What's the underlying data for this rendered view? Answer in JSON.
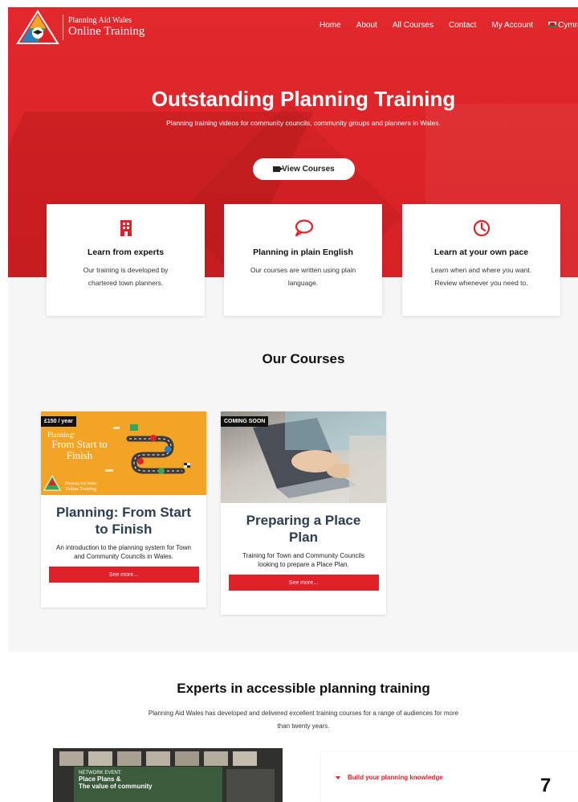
{
  "brand": {
    "line1": "Planning Aid Wales",
    "line2": "Online Training"
  },
  "nav": [
    "Home",
    "About",
    "All Courses",
    "Contact",
    "My Account"
  ],
  "nav_language": "Cymra",
  "hero": {
    "title": "Outstanding Planning Training",
    "subtitle": "Planning training videos for community councils, community groups and planners in Wales.",
    "button": "View Courses"
  },
  "features": [
    {
      "icon": "building-icon",
      "title": "Learn from experts",
      "desc": "Our training is developed by chartered town planners."
    },
    {
      "icon": "speech-bubble-icon",
      "title": "Planning in plain English",
      "desc": "Our courses are written using plain language."
    },
    {
      "icon": "clock-icon",
      "title": "Learn at your own pace",
      "desc": "Learn when and where you want. Review whenever you need to."
    }
  ],
  "courses_heading": "Our Courses",
  "courses": [
    {
      "badge": "£150 / year",
      "image_label": "Planning:",
      "image_title": "From Start to Finish",
      "image_brand_1": "Planning Aid Wales",
      "image_brand_2": "Online Training",
      "title": "Planning: From Start to Finish",
      "desc": "An introduction to the planning system for Town and Community Councils in Wales.",
      "button": "See more..."
    },
    {
      "badge": "COMING SOON",
      "title": "Preparing a Place Plan",
      "desc": "Training for Town and Community Councils looking to prepare a Place Plan.",
      "button": "See more..."
    }
  ],
  "experts": {
    "title": "Experts in accessible planning training",
    "desc": "Planning Aid Wales has developed and delivered excellent training courses for a range of audiences for more than twenty years."
  },
  "photo_text": {
    "line1": "NETWORK EVENT:",
    "line2": "Place Plans &",
    "line3": "The value of community"
  },
  "accordion": {
    "item1": "Build your planning knowledge"
  },
  "page_number": "7",
  "colors": {
    "brand_red": "#e02129",
    "hero_red": "#dc2428",
    "title_navy": "#2c3e50"
  }
}
